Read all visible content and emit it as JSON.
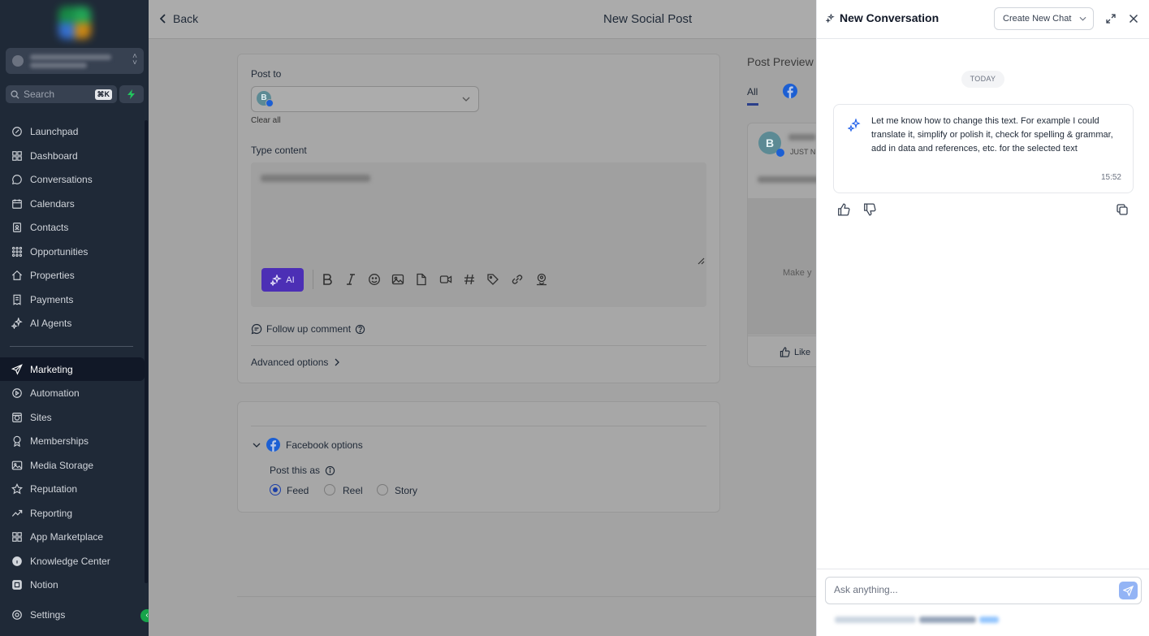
{
  "sidebar": {
    "search_placeholder": "Search",
    "search_shortcut": "⌘K",
    "items": [
      {
        "label": "Launchpad",
        "icon": "rocket-icon"
      },
      {
        "label": "Dashboard",
        "icon": "grid-icon"
      },
      {
        "label": "Conversations",
        "icon": "chat-icon"
      },
      {
        "label": "Calendars",
        "icon": "calendar-icon"
      },
      {
        "label": "Contacts",
        "icon": "contacts-icon"
      },
      {
        "label": "Opportunities",
        "icon": "funnel-icon"
      },
      {
        "label": "Properties",
        "icon": "home-icon"
      },
      {
        "label": "Payments",
        "icon": "receipt-icon"
      },
      {
        "label": "AI Agents",
        "icon": "sparkle-icon"
      },
      {
        "label": "Marketing",
        "icon": "send-icon",
        "active": true
      },
      {
        "label": "Automation",
        "icon": "automation-icon"
      },
      {
        "label": "Sites",
        "icon": "globe-icon"
      },
      {
        "label": "Memberships",
        "icon": "award-icon"
      },
      {
        "label": "Media Storage",
        "icon": "image-icon"
      },
      {
        "label": "Reputation",
        "icon": "star-icon"
      },
      {
        "label": "Reporting",
        "icon": "trend-icon"
      },
      {
        "label": "App Marketplace",
        "icon": "apps-icon"
      },
      {
        "label": "Knowledge Center",
        "icon": "info-icon"
      },
      {
        "label": "Notion",
        "icon": "notion-icon"
      }
    ],
    "settings_label": "Settings"
  },
  "main": {
    "back_label": "Back",
    "title": "New Social Post",
    "post_to_label": "Post to",
    "avatar_letter": "B",
    "clear_all": "Clear all",
    "type_content_label": "Type content",
    "ai_label": "AI",
    "follow_up": "Follow up comment",
    "advanced": "Advanced options",
    "facebook_options": "Facebook options",
    "post_this_as": "Post this as",
    "options": [
      "Feed",
      "Reel",
      "Story"
    ],
    "selected_option": "Feed",
    "preview_title": "Post Preview",
    "preview_tab_all": "All",
    "preview_avatar": "B",
    "preview_time": "JUST N",
    "preview_make": "Make y",
    "preview_like": "Like"
  },
  "panel": {
    "title": "New Conversation",
    "create_chat": "Create New Chat",
    "today": "TODAY",
    "message": "Let me know how to change this text. For example I could translate it, simplify or polish it, check for spelling & grammar, add in data and references, etc. for the selected text",
    "time": "15:52",
    "input_placeholder": "Ask anything..."
  },
  "colors": {
    "accent": "#4c2fb5",
    "sidebar_bg": "#1f2937",
    "facebook": "#1877f2"
  }
}
